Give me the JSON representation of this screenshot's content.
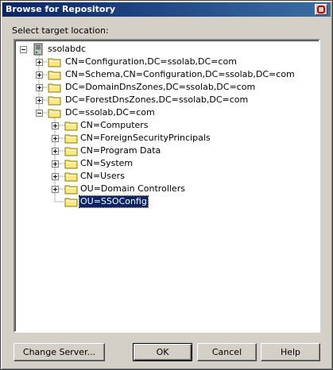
{
  "window": {
    "title": "Browse for Repository"
  },
  "prompt": "Select target location:",
  "tree": {
    "root": {
      "label": "ssolabdc"
    },
    "items": [
      {
        "label": "CN=Configuration,DC=ssolab,DC=com",
        "level": 1,
        "expander": "plus"
      },
      {
        "label": "CN=Schema,CN=Configuration,DC=ssolab,DC=com",
        "level": 1,
        "expander": "plus"
      },
      {
        "label": "DC=DomainDnsZones,DC=ssolab,DC=com",
        "level": 1,
        "expander": "plus"
      },
      {
        "label": "DC=ForestDnsZones,DC=ssolab,DC=com",
        "level": 1,
        "expander": "plus"
      },
      {
        "label": "DC=ssolab,DC=com",
        "level": 1,
        "expander": "minus"
      },
      {
        "label": "CN=Computers",
        "level": 2,
        "expander": "plus"
      },
      {
        "label": "CN=ForeignSecurityPrincipals",
        "level": 2,
        "expander": "plus"
      },
      {
        "label": "CN=Program Data",
        "level": 2,
        "expander": "plus"
      },
      {
        "label": "CN=System",
        "level": 2,
        "expander": "plus"
      },
      {
        "label": "CN=Users",
        "level": 2,
        "expander": "plus"
      },
      {
        "label": "OU=Domain Controllers",
        "level": 2,
        "expander": "plus"
      },
      {
        "label": "OU=SSOConfig",
        "level": 2,
        "expander": "none",
        "selected": true
      }
    ]
  },
  "buttons": {
    "change_server": "Change Server...",
    "ok": "OK",
    "cancel": "Cancel",
    "help": "Help"
  },
  "colors": {
    "selection": "#0a246a",
    "folder": "#ffe680",
    "titlebar": "#0a246a"
  }
}
